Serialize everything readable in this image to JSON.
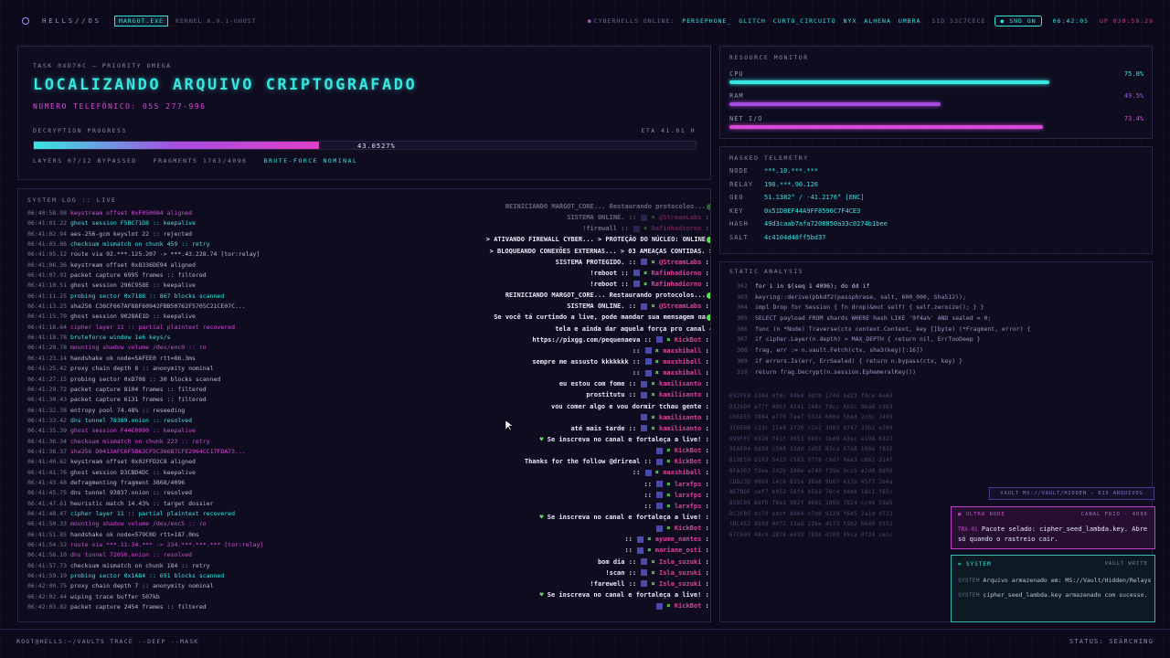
{
  "topbar": {
    "brand": "HELLS//OS",
    "process_chip": "MARGOT.EXE",
    "kernel": "KERNEL 6.9.1-GHOST",
    "online_label": "CYBERHELLS ONLINE:",
    "online_users": [
      "PERSEPHONE_",
      "GLITCH",
      "CURTO_CIRCUITO",
      "NYX",
      "ALHENA",
      "UMBRA"
    ],
    "sid": "SID 53C7CECE",
    "snd_chip": "SND ON",
    "clock": "06:42:05",
    "uptime": "UP 030:59:29"
  },
  "task": {
    "label": "TASK 0XD70C — PRIORITY OMEGA",
    "title": "LOCALIZANDO ARQUIVO CRIPTOGRAFADO",
    "phone": "NÚMERO TELEFÔNICO: 055 277-996",
    "progress_label": "DECRYPTION PROGRESS",
    "eta": "ETA 41.01 H",
    "progress_percent_text": "43.0527%",
    "progress_fraction": 0.430527,
    "layers": "LAYERS 07/12 BYPASSED",
    "fragments": "FRAGMENTS 1763/4096",
    "bruteforce": "BRUTE-FORCE NOMINAL"
  },
  "log": {
    "title": "SYSTEM LOG :: LIVE",
    "lines": [
      {
        "t": "06:40:58.98",
        "m": "keystream offset 0xF050084 aligned",
        "c": "mag"
      },
      {
        "t": "06:41:01.22",
        "m": "ghost session F5BC71D8 :: keepalive",
        "c": "cyan"
      },
      {
        "t": "06:41:02.94",
        "m": "aes-256-gcm keyslot 22 :: rejected",
        "c": "normal"
      },
      {
        "t": "06:41:03.86",
        "m": "checksum mismatch on chunk 459 :: retry",
        "c": "cyan"
      },
      {
        "t": "06:41:05.12",
        "m": "route via 92.***.125.207 -> ***.43.228.74 [tor:relay]",
        "c": "normal"
      },
      {
        "t": "06:41:06.36",
        "m": "keystream offset 0x8336DE94 aligned",
        "c": "normal"
      },
      {
        "t": "06:41:07.91",
        "m": "packet capture 6995 frames :: filtered",
        "c": "normal"
      },
      {
        "t": "06:41:10.51",
        "m": "ghost session 296C958E :: keepalive",
        "c": "normal"
      },
      {
        "t": "06:41:11.25",
        "m": "probing sector 0x7188 :: 867 blocks scanned",
        "c": "cyan"
      },
      {
        "t": "06:41:13.25",
        "m": "sha256 C36CF667AF88F60942FBB50762F5705C21CE07C...",
        "c": "normal"
      },
      {
        "t": "06:41:15.79",
        "m": "ghost session 9028AE1D :: keepalive",
        "c": "normal"
      },
      {
        "t": "06:41:16.64",
        "m": "cipher layer 11 :: partial plaintext recovered",
        "c": "mag"
      },
      {
        "t": "06:41:18.78",
        "m": "bruteforce window 1e6 keys/s",
        "c": "cyan"
      },
      {
        "t": "06:41:20.78",
        "m": "mounting shadow volume /dev/enc0 :: ro",
        "c": "mag"
      },
      {
        "t": "06:41:23.14",
        "m": "handshake ok node=5AFEE0 rtt=86.3ms",
        "c": "normal"
      },
      {
        "t": "06:41:25.42",
        "m": "proxy chain depth 8 :: anonymity nominal",
        "c": "normal"
      },
      {
        "t": "06:41:27.15",
        "m": "probing sector 0xD708 :: 30 blocks scanned",
        "c": "normal"
      },
      {
        "t": "06:41:29.72",
        "m": "packet capture 8104 frames :: filtered",
        "c": "normal"
      },
      {
        "t": "06:41:30.43",
        "m": "packet capture 6131 frames :: filtered",
        "c": "normal"
      },
      {
        "t": "06:41:32.38",
        "m": "entropy pool 74.48% :: reseeding",
        "c": "normal"
      },
      {
        "t": "06:41:33.42",
        "m": "dns tunnel 78389.onion :: resolved",
        "c": "cyan"
      },
      {
        "t": "06:41:35.39",
        "m": "ghost session F44C0990 :: keepalive",
        "c": "mag"
      },
      {
        "t": "06:41:36.34",
        "m": "checksum mismatch on chunk 223 :: retry",
        "c": "mag"
      },
      {
        "t": "06:41:38.37",
        "m": "sha256 D0413AFC6F5B63CF5C366B7CFE2964CC17FDA73...",
        "c": "mag"
      },
      {
        "t": "06:41:40.62",
        "m": "keystream offset 0x02FFD2C8 aligned",
        "c": "normal"
      },
      {
        "t": "06:41:41.76",
        "m": "ghost session D3CBD4DC :: keepalive",
        "c": "normal"
      },
      {
        "t": "06:41:43.48",
        "m": "defragmenting fragment 3868/4096",
        "c": "normal"
      },
      {
        "t": "06:41:45.75",
        "m": "dns tunnel 93837.onion :: resolved",
        "c": "normal"
      },
      {
        "t": "06:41:47.61",
        "m": "heuristic match 14.43% :: target dossier",
        "c": "normal"
      },
      {
        "t": "06:41:48.47",
        "m": "cipher layer 11 :: partial plaintext recovered",
        "c": "cyan"
      },
      {
        "t": "06:41:50.33",
        "m": "mounting shadow volume /dev/enc5 :: ro",
        "c": "mag"
      },
      {
        "t": "06:41:51.85",
        "m": "handshake ok node=579C0D rtt=187.0ms",
        "c": "normal"
      },
      {
        "t": "06:41:54.32",
        "m": "route via ***.11.34.*** -> 234.***.***.*** [tor:relay]",
        "c": "mag"
      },
      {
        "t": "06:41:56.10",
        "m": "dns tunnel 72050.onion :: resolved",
        "c": "mag"
      },
      {
        "t": "06:41:57.73",
        "m": "checksum mismatch on chunk 184 :: retry",
        "c": "normal"
      },
      {
        "t": "06:41:59.19",
        "m": "probing sector 0x1A84 :: 691 blocks scanned",
        "c": "cyan"
      },
      {
        "t": "06:42:00.75",
        "m": "proxy chain depth 7 :: anonymity nominal",
        "c": "normal"
      },
      {
        "t": "06:42:02.44",
        "m": "wiping trace buffer 507kb",
        "c": "normal"
      },
      {
        "t": "06:42:03.82",
        "m": "packet capture 2454 frames :: filtered",
        "c": "normal"
      }
    ]
  },
  "chat": {
    "lines": [
      {
        "pre": "REINICIANDO MARGOT_CORE... Restaurando protocolos...",
        "user": "",
        "faded": true
      },
      {
        "pre": "SISTEMA ONLINE. :: ",
        "user": "@StreamLabs",
        "faded": true
      },
      {
        "pre": "!firewall :: ",
        "user": "Rafinhadiorno",
        "faded": true
      },
      {
        "pre": "> ATIVANDO FIREWALL CYBER... > PROTEÇÃO DO NÚCLEO: ONLINE",
        "user": "",
        "faded": false
      },
      {
        "pre": "> BLOQUEANDO CONEXÕES EXTERNAS... > 03 AMEAÇAS CONTIDAS. >",
        "user": "",
        "faded": false
      },
      {
        "pre": "SISTEMA PROTEGIDO. :: ",
        "user": "@StreamLabs",
        "faded": false
      },
      {
        "pre": "!reboot :: ",
        "user": "Rafinhadiorno",
        "faded": false
      },
      {
        "pre": "!reboot :: ",
        "user": "Rafinhadiorno",
        "faded": false
      },
      {
        "pre": "REINICIANDO MARGOT_CORE... Restaurando protocolos...",
        "user": "",
        "faded": false
      },
      {
        "pre": "SISTEMA ONLINE. :: ",
        "user": "@StreamLabs",
        "faded": false
      },
      {
        "pre": "Se você tá curtindo a live, pode mandar sua mensagem na",
        "user": "",
        "faded": false
      },
      {
        "pre": "tela e ainda dar aquela força pro canal →",
        "user": "",
        "faded": false
      },
      {
        "pre": "https://pixgg.com/pequenaeva :: ",
        "user": "KickBot",
        "faded": false
      },
      {
        "pre": ":: ",
        "user": "maxshiball",
        "faded": false
      },
      {
        "pre": "sempre me assusto kkkkkkk :: ",
        "user": "maxshiball",
        "faded": false
      },
      {
        "pre": ":: ",
        "user": "maxshiball",
        "faded": false
      },
      {
        "pre": "eu estou com fome :: ",
        "user": "kamilisanto",
        "faded": false
      },
      {
        "pre": "prostitutu :: ",
        "user": "kamilisanto",
        "faded": false
      },
      {
        "pre": "vou comer algo e vou dormir tchau gente ::",
        "user": "",
        "faded": false
      },
      {
        "pre": "",
        "user": "kamilisanto",
        "faded": false
      },
      {
        "pre": "até mais tarde :: ",
        "user": "kamilisanto",
        "faded": false
      },
      {
        "pre": "Se inscreva no canal e fortaleça a live! ::",
        "user": "",
        "faded": false,
        "green": true
      },
      {
        "pre": "",
        "user": "KickBot",
        "faded": false
      },
      {
        "pre": "Thanks for the follow @drireal :: ",
        "user": "KickBot",
        "faded": false
      },
      {
        "pre": ":: ",
        "user": "maxshiball",
        "faded": false
      },
      {
        "pre": ":: ",
        "user": "larxfps",
        "faded": false
      },
      {
        "pre": ":: ",
        "user": "larxfps",
        "faded": false
      },
      {
        "pre": ":: ",
        "user": "larxfps",
        "faded": false
      },
      {
        "pre": "Se inscreva no canal e fortaleça a live! ::",
        "user": "",
        "faded": false,
        "green": true
      },
      {
        "pre": "",
        "user": "KickBot",
        "faded": false
      },
      {
        "pre": ":: ",
        "user": "ayume_nantes",
        "faded": false
      },
      {
        "pre": ":: ",
        "user": "mariane_osti",
        "faded": false
      },
      {
        "pre": "bom dia :: ",
        "user": "Isla_suzuki",
        "faded": false
      },
      {
        "pre": "!scan :: ",
        "user": "Isla_suzuki",
        "faded": false
      },
      {
        "pre": "!farewell :: ",
        "user": "Isla_suzuki",
        "faded": false
      },
      {
        "pre": "Se inscreva no canal e fortaleça a live! ::",
        "user": "",
        "faded": false,
        "green": true
      },
      {
        "pre": "",
        "user": "KickBot",
        "faded": false
      }
    ]
  },
  "resource": {
    "title": "RESOURCE MONITOR",
    "cpu_label": "CPU",
    "cpu_text": "75.0%",
    "cpu": 0.75,
    "ram_label": "RAM",
    "ram_text": "49.5%",
    "ram": 0.495,
    "net_label": "NET I/O",
    "net_text": "73.4%",
    "net": 0.734,
    "colors": {
      "cpu": "#37e6e0",
      "ram": "#a74ee0",
      "net": "#d84ad8"
    }
  },
  "telemetry": {
    "title": "MASKED TELEMETRY",
    "rows": [
      {
        "k": "NODE",
        "v": "***.10.***.***"
      },
      {
        "k": "RELAY",
        "v": "190.***.90.126"
      },
      {
        "k": "GEO",
        "v": "51.1382° / -41.2176° [ENC]"
      },
      {
        "k": "KEY",
        "v": "0x51D8EF44A9FF8596C7F4CE3"
      },
      {
        "k": "HASH",
        "v": "49d3caab7afa7208850a33c0274b1bee"
      },
      {
        "k": "SALT",
        "v": "4c4104d48ff5bd37"
      }
    ]
  },
  "static": {
    "title": "STATIC ANALYSIS",
    "code": [
      {
        "n": "302",
        "c": "for i in $(seq 1 4096); do dd if"
      },
      {
        "n": "303",
        "c": "keyring::derive(pbkdf2(passphrase, salt, 600_000, Sha512));"
      },
      {
        "n": "304",
        "c": "impl Drop for Session { fn drop(&mut self) { self.zeroize(); } }"
      },
      {
        "n": "305",
        "c": "SELECT payload FROM shards WHERE hash LIKE '9f4a%' AND sealed = 0;"
      },
      {
        "n": "306",
        "c": "func (n *Node) Traverse(ctx context.Context, key []byte) (*Fragment, error) {"
      },
      {
        "n": "307",
        "c": "if cipher.Layer(n.depth) > MAX_DEPTH { return nil, ErrTooDeep }"
      },
      {
        "n": "308",
        "c": "frag, err := n.vault.Fetch(ctx, sha3(key)[:16])"
      },
      {
        "n": "309",
        "c": "if errors.Is(err, ErrSealed) { return n.bypass(ctx, key) }"
      },
      {
        "n": "310",
        "c": "return frag.Decrypt(n.session.EphemeralKey())"
      }
    ],
    "hex": [
      "E92FE8  d304 0f0c 94b4 3dfb 1746 bd22 f9ce 4e63",
      "D326D0  e77f 0053 4241 248c fdcc 6b5c 8ba6 cdb3",
      "C6EEE5  f884 e779 7ae7 5324 600d 56ed 2c6c 1495",
      "316E08  c23c 11e9 2f20 c2e2 3d83 d747 33b2 e309",
      "899FFC  b326 f41f 3653 683c 1bd9 43ec e198 6327",
      "9EAE04  bd39 c508 33dd 2d55 83ca b7a8 106e f835",
      "619E59  b193 5413 c583 97f0 c9d7 0ee3 c862 314f",
      "6FA302  f2ee 2d2b 399e a740 f39e 9cc5 e2d8 8d96",
      "CDD23D  9069 14c6 831e 38a8 9b67 e17b 45f7 2b4a",
      "AE7BDF  cef7 b052 56f4 b5b2 76c4 0de0 18c1 f65c",
      "85BC05  6bf0 f6a3 982f 4091 2895 7824 cc44 59a5",
      "DC3FB5  bc79 edcf 8d64 c7d0 9129 f6d5 2a1d 9723",
      "1BC452  959d 00f2 22ad 22be 4573 55b2 6649 9352",
      "67C600  48c0 2878 e039 783b e209 05ca 0f24 ce1c"
    ]
  },
  "vault_tag": "VAULT MS://VAULT/HIDDEN — 015 ARQUIVOS",
  "ultra": {
    "label": "ULTRA NODE",
    "channel": "CANAL FRIO · 4096",
    "trx": "TRX-01",
    "message": "Pacote selado: cipher_seed_lambda.key. Abre só quando o rastreio cair."
  },
  "system_card": {
    "label": "SYSTEM",
    "right": "VAULT WRITE",
    "line1_tag": "SYSTEM",
    "line1": "Arquivo armazenado em: MS://Vault/Hidden/Relays",
    "line2_tag": "SYSTEM",
    "line2": "cipher_seed_lambda.key armazenado com sucesso."
  },
  "bottombar": {
    "prompt": "ROOT@HELLS:~/VAULTS TRACE --DEEP --MASK",
    "status": "STATUS: SEARCHING"
  }
}
